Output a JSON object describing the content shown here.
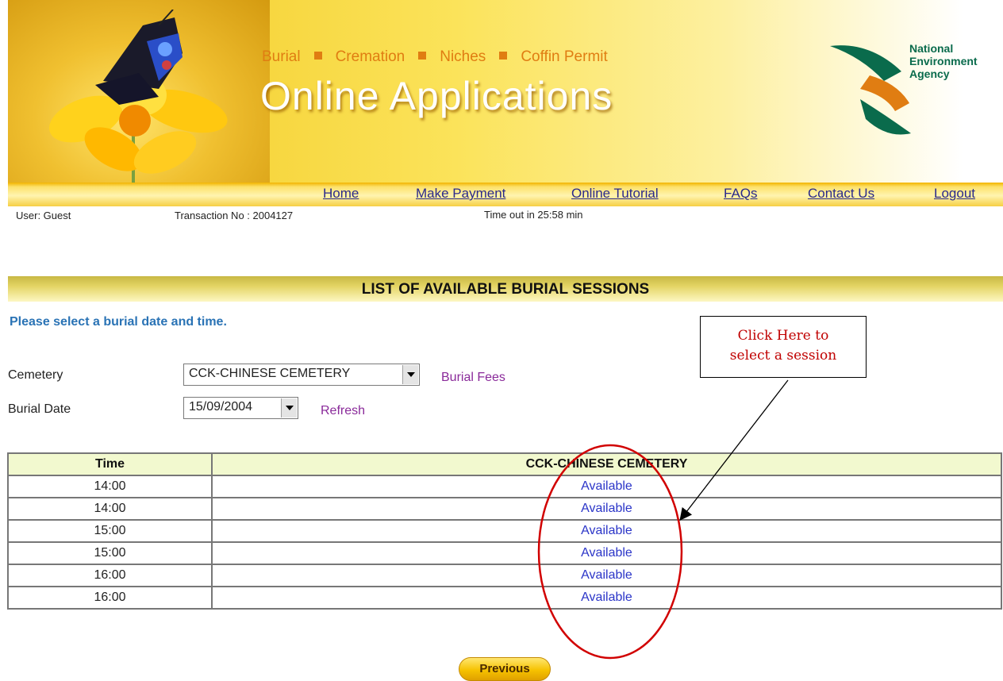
{
  "banner": {
    "services": [
      "Burial",
      "Cremation",
      "Niches",
      "Coffin Permit"
    ],
    "title": "Online Applications",
    "agency_lines": [
      "National",
      "Environment",
      "Agency"
    ]
  },
  "nav": {
    "items": [
      "Home",
      "Make Payment",
      "Online Tutorial",
      "FAQs",
      "Contact Us",
      "Logout"
    ]
  },
  "status": {
    "user": "User: Guest",
    "transaction": "Transaction No : 2004127",
    "timeout": "Time out in 25:58 min"
  },
  "section": {
    "title": "LIST OF AVAILABLE BURIAL SESSIONS",
    "instruction": "Please select a burial date and time."
  },
  "form": {
    "cemetery_label": "Cemetery",
    "cemetery_value": "CCK-CHINESE CEMETERY",
    "burial_fees_link": "Burial Fees",
    "date_label": "Burial Date",
    "date_value": "15/09/2004",
    "refresh_link": "Refresh"
  },
  "callout": {
    "text": "Click Here to\nselect a session"
  },
  "table": {
    "headers": [
      "Time",
      "CCK-CHINESE CEMETERY"
    ],
    "rows": [
      {
        "time": "14:00",
        "status": "Available"
      },
      {
        "time": "14:00",
        "status": "Available"
      },
      {
        "time": "15:00",
        "status": "Available"
      },
      {
        "time": "15:00",
        "status": "Available"
      },
      {
        "time": "16:00",
        "status": "Available"
      },
      {
        "time": "16:00",
        "status": "Available"
      }
    ]
  },
  "buttons": {
    "previous": "Previous"
  },
  "colors": {
    "accent_yellow": "#f6c200",
    "link_blue": "#2b35c8",
    "callout_red": "#c00000",
    "agency_green": "#0a6b4c",
    "agency_orange": "#e07d12"
  }
}
